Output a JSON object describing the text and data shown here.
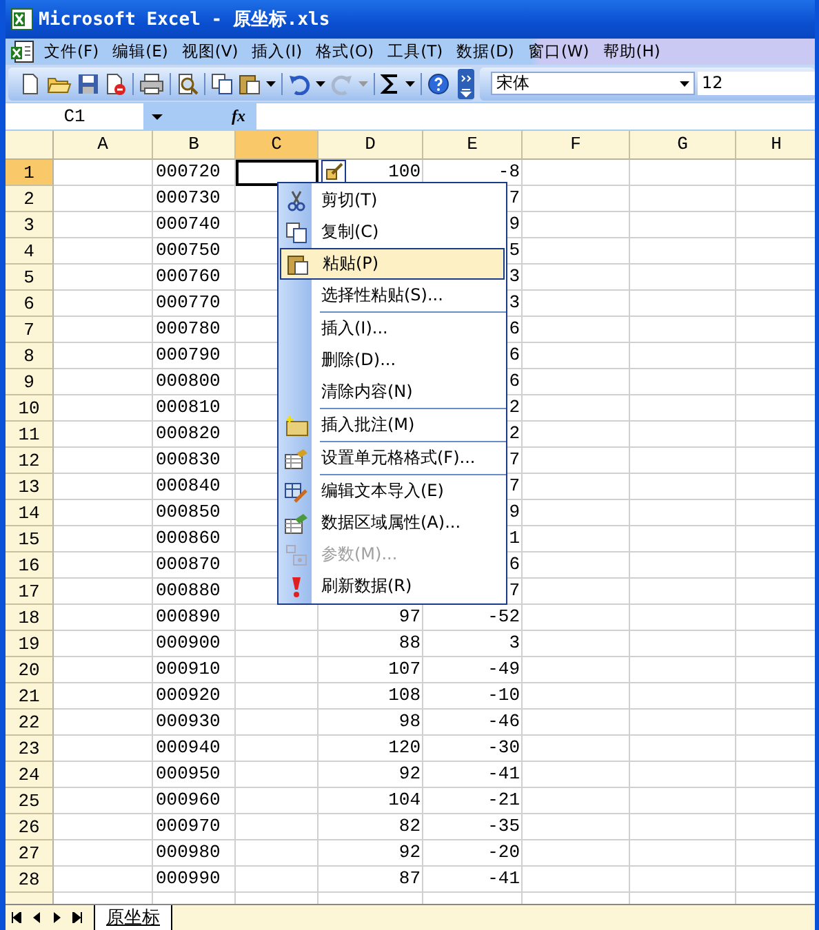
{
  "window": {
    "title": "Microsoft Excel - 原坐标.xls"
  },
  "menu_bar": [
    "文件(F)",
    "编辑(E)",
    "视图(V)",
    "插入(I)",
    "格式(O)",
    "工具(T)",
    "数据(D)",
    "窗口(W)",
    "帮助(H)"
  ],
  "toolbar": {
    "font": "宋体",
    "font_size": "12"
  },
  "formula_bar": {
    "name_box": "C1",
    "function_label": "fx"
  },
  "sheet": {
    "columns": [
      {
        "label": "A",
        "selected": false
      },
      {
        "label": "B",
        "selected": false
      },
      {
        "label": "C",
        "selected": true
      },
      {
        "label": "D",
        "selected": false
      },
      {
        "label": "E",
        "selected": false
      },
      {
        "label": "F",
        "selected": false
      },
      {
        "label": "G",
        "selected": false
      },
      {
        "label": "H",
        "selected": false
      }
    ],
    "rows": [
      {
        "number": "1",
        "selected": true,
        "b": "000720",
        "d": "100",
        "e": "-8"
      },
      {
        "number": "2",
        "selected": false,
        "b": "000730",
        "e": "7"
      },
      {
        "number": "3",
        "selected": false,
        "b": "000740",
        "e": "9"
      },
      {
        "number": "4",
        "selected": false,
        "b": "000750",
        "e": "5"
      },
      {
        "number": "5",
        "selected": false,
        "b": "000760",
        "e": "3"
      },
      {
        "number": "6",
        "selected": false,
        "b": "000770",
        "e": "3"
      },
      {
        "number": "7",
        "selected": false,
        "b": "000780",
        "e": "6"
      },
      {
        "number": "8",
        "selected": false,
        "b": "000790",
        "e": "6"
      },
      {
        "number": "9",
        "selected": false,
        "b": "000800",
        "e": "6"
      },
      {
        "number": "10",
        "selected": false,
        "b": "000810",
        "e": "2"
      },
      {
        "number": "11",
        "selected": false,
        "b": "000820",
        "e": "2"
      },
      {
        "number": "12",
        "selected": false,
        "b": "000830",
        "e": "7"
      },
      {
        "number": "13",
        "selected": false,
        "b": "000840",
        "e": "7"
      },
      {
        "number": "14",
        "selected": false,
        "b": "000850",
        "e": "9"
      },
      {
        "number": "15",
        "selected": false,
        "b": "000860",
        "e": "1"
      },
      {
        "number": "16",
        "selected": false,
        "b": "000870",
        "e": "6"
      },
      {
        "number": "17",
        "selected": false,
        "b": "000880",
        "e": "7"
      },
      {
        "number": "18",
        "selected": false,
        "b": "000890",
        "d": "97",
        "e": "-52"
      },
      {
        "number": "19",
        "selected": false,
        "b": "000900",
        "d": "88",
        "e": "3"
      },
      {
        "number": "20",
        "selected": false,
        "b": "000910",
        "d": "107",
        "e": "-49"
      },
      {
        "number": "21",
        "selected": false,
        "b": "000920",
        "d": "108",
        "e": "-10"
      },
      {
        "number": "22",
        "selected": false,
        "b": "000930",
        "d": "98",
        "e": "-46"
      },
      {
        "number": "23",
        "selected": false,
        "b": "000940",
        "d": "120",
        "e": "-30"
      },
      {
        "number": "24",
        "selected": false,
        "b": "000950",
        "d": "92",
        "e": "-41"
      },
      {
        "number": "25",
        "selected": false,
        "b": "000960",
        "d": "104",
        "e": "-21"
      },
      {
        "number": "26",
        "selected": false,
        "b": "000970",
        "d": "82",
        "e": "-35"
      },
      {
        "number": "27",
        "selected": false,
        "b": "000980",
        "d": "92",
        "e": "-20"
      },
      {
        "number": "28",
        "selected": false,
        "b": "000990",
        "d": "87",
        "e": "-41"
      }
    ]
  },
  "context_menu": {
    "items": [
      {
        "label": "剪切(T)",
        "highlighted": false,
        "disabled": false,
        "separator_before": false
      },
      {
        "label": "复制(C)",
        "highlighted": false,
        "disabled": false,
        "separator_before": false
      },
      {
        "label": "粘贴(P)",
        "highlighted": true,
        "disabled": false,
        "separator_before": false
      },
      {
        "label": "选择性粘贴(S)...",
        "highlighted": false,
        "disabled": false,
        "separator_before": false
      },
      {
        "label": "插入(I)...",
        "highlighted": false,
        "disabled": false,
        "separator_before": true
      },
      {
        "label": "删除(D)...",
        "highlighted": false,
        "disabled": false,
        "separator_before": false
      },
      {
        "label": "清除内容(N)",
        "highlighted": false,
        "disabled": false,
        "separator_before": false
      },
      {
        "label": "插入批注(M)",
        "highlighted": false,
        "disabled": false,
        "separator_before": true
      },
      {
        "label": "设置单元格格式(F)...",
        "highlighted": false,
        "disabled": false,
        "separator_before": true
      },
      {
        "label": "编辑文本导入(E)",
        "highlighted": false,
        "disabled": false,
        "separator_before": true
      },
      {
        "label": "数据区域属性(A)...",
        "highlighted": false,
        "disabled": false,
        "separator_before": false
      },
      {
        "label": "参数(M)...",
        "highlighted": false,
        "disabled": true,
        "separator_before": false
      },
      {
        "label": "刷新数据(R)",
        "highlighted": false,
        "disabled": false,
        "separator_before": false
      }
    ]
  },
  "sheet_tabs": [
    {
      "label": "原坐标",
      "selected": true
    }
  ]
}
